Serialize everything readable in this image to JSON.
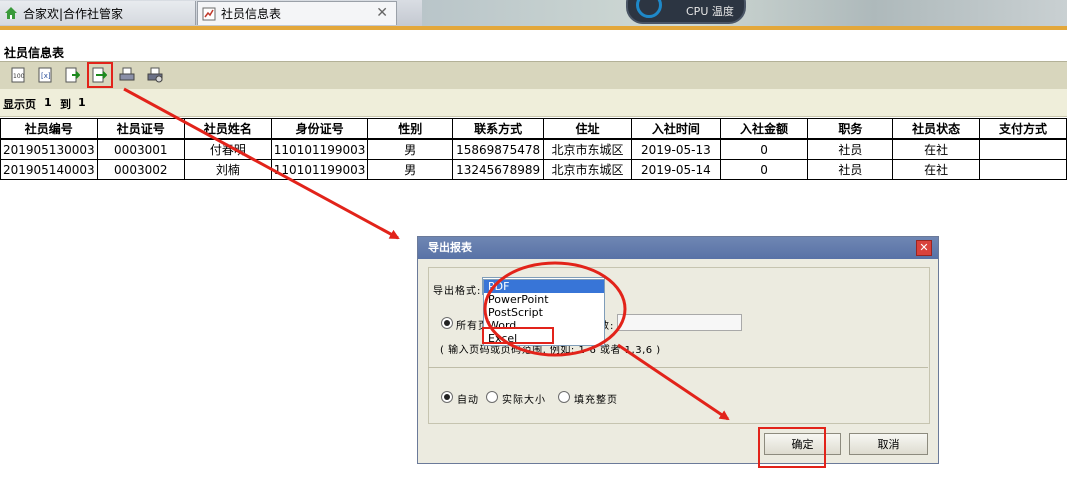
{
  "tabs": [
    {
      "label": "合家欢|合作社管家"
    },
    {
      "label": "社员信息表",
      "close": "✕"
    }
  ],
  "cpu_widget": {
    "text": "CPU 温度"
  },
  "report": {
    "title": "社员信息表",
    "toolbar": [
      "first-page-icon",
      "prev-page-icon",
      "next-page-icon",
      "export-icon",
      "print-icon",
      "print-setup-icon"
    ],
    "page_info": {
      "show": "显示页",
      "from": "1",
      "to_word": "到",
      "to": "1"
    },
    "columns": [
      "社员编号",
      "社员证号",
      "社员姓名",
      "身份证号",
      "性别",
      "联系方式",
      "住址",
      "入社时间",
      "入社金额",
      "职务",
      "社员状态",
      "支付方式"
    ],
    "rows": [
      [
        "201905130003",
        "0003001",
        "付春明",
        "110101199003",
        "男",
        "15869875478",
        "北京市东城区",
        "2019-05-13",
        "0",
        "社员",
        "在社",
        ""
      ],
      [
        "201905140003",
        "0003002",
        "刘楠",
        "110101199003",
        "男",
        "13245678989",
        "北京市东城区",
        "2019-05-14",
        "0",
        "社员",
        "在社",
        ""
      ]
    ]
  },
  "dialog": {
    "title": "导出报表",
    "format_label": "导出格式:",
    "format_options": [
      "PDF",
      "PowerPoint",
      "PostScript",
      "Word",
      "Excel"
    ],
    "format_selected": "PDF",
    "range_all": "所有页",
    "range_pages_label": "页数:",
    "range_hint": "( 输入页码或页码范围, 例如: 1-6 或者 1,3,6 )",
    "scale_auto": "自动",
    "scale_actual": "实际大小",
    "scale_fill": "填充整页",
    "ok": "确定",
    "cancel": "取消"
  },
  "colors": {
    "annotation": "#e2231a",
    "accent_line": "#e3a73a",
    "dialog_title": "#5f78aa"
  }
}
